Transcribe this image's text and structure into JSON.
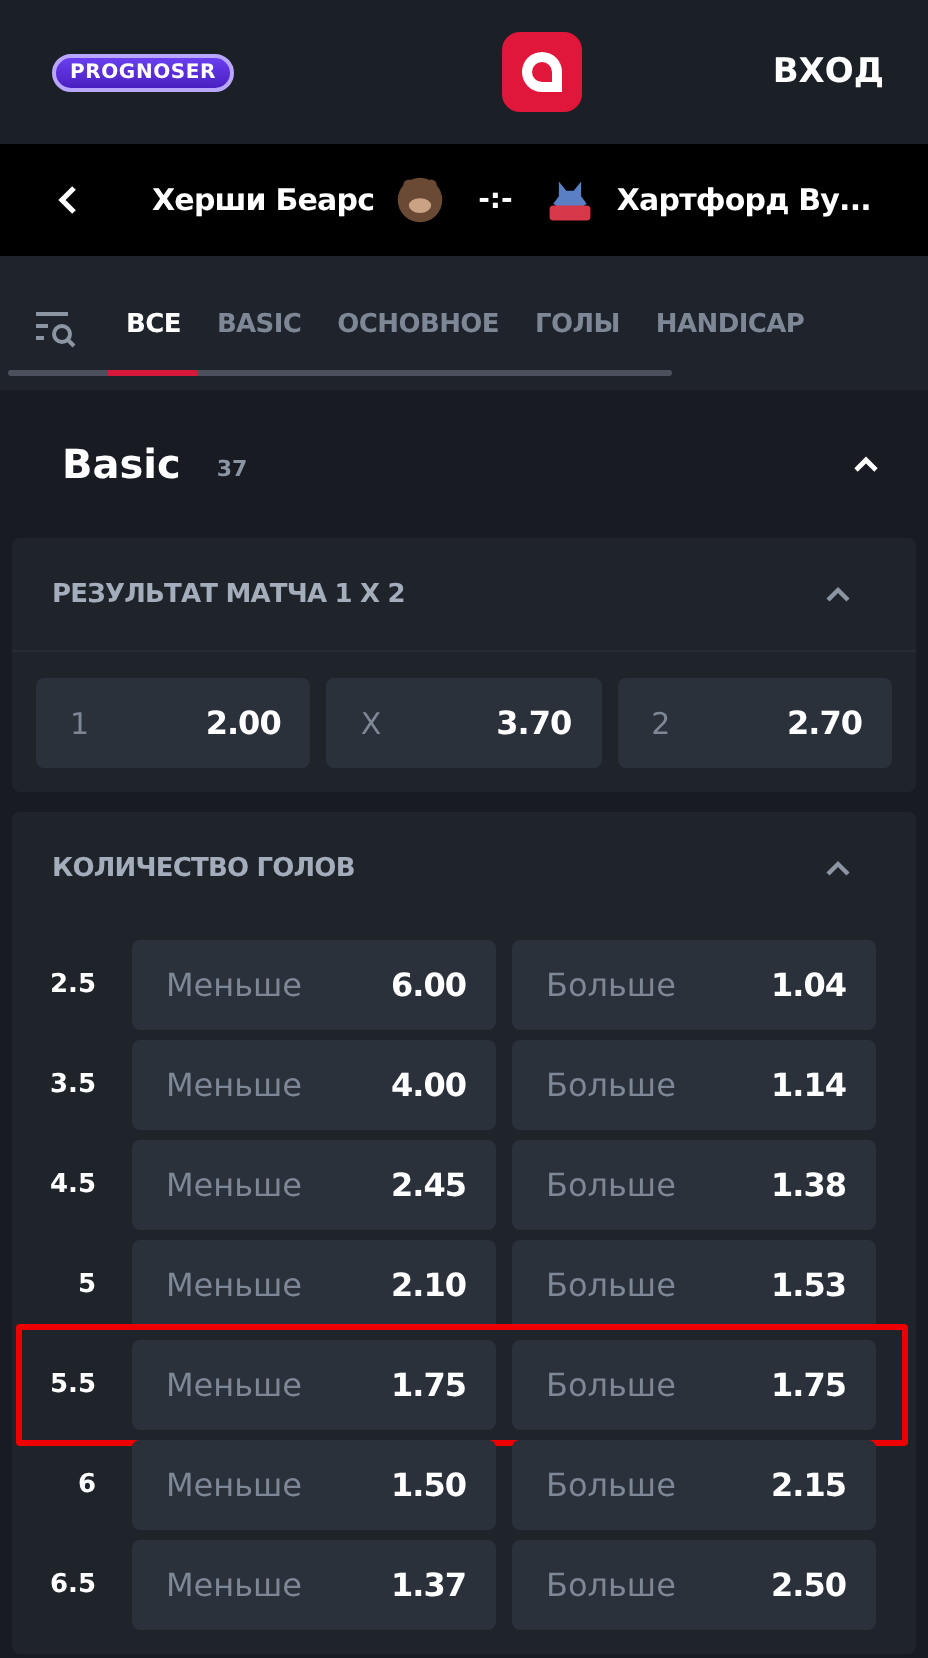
{
  "header": {
    "brand_badge": "PROGNOSER",
    "login": "ВХОД"
  },
  "match": {
    "home": "Херши Беарс",
    "score": "-:-",
    "away": "Хартфорд Ву..."
  },
  "tabs": [
    {
      "label": "ВСЕ",
      "selected": true
    },
    {
      "label": "BASIC",
      "selected": false
    },
    {
      "label": "ОСНОВНОЕ",
      "selected": false
    },
    {
      "label": "ГОЛЫ",
      "selected": false
    },
    {
      "label": "HANDICAP",
      "selected": false
    }
  ],
  "section": {
    "title": "Basic",
    "count": "37",
    "expanded": true
  },
  "markets": [
    {
      "title": "РЕЗУЛЬТАТ МАТЧА 1 X 2",
      "expanded": true,
      "kind": "outcomes",
      "outcomes": [
        {
          "label": "1",
          "odds": "2.00"
        },
        {
          "label": "X",
          "odds": "3.70"
        },
        {
          "label": "2",
          "odds": "2.70"
        }
      ]
    },
    {
      "title": "КОЛИЧЕСТВО ГОЛОВ",
      "expanded": true,
      "kind": "totals",
      "rows": [
        {
          "line": "2.5",
          "under": "Меньше",
          "under_odds": "6.00",
          "over": "Больше",
          "over_odds": "1.04",
          "highlighted": false
        },
        {
          "line": "3.5",
          "under": "Меньше",
          "under_odds": "4.00",
          "over": "Больше",
          "over_odds": "1.14",
          "highlighted": false
        },
        {
          "line": "4.5",
          "under": "Меньше",
          "under_odds": "2.45",
          "over": "Больше",
          "over_odds": "1.38",
          "highlighted": false
        },
        {
          "line": "5",
          "under": "Меньше",
          "under_odds": "2.10",
          "over": "Больше",
          "over_odds": "1.53",
          "highlighted": false
        },
        {
          "line": "5.5",
          "under": "Меньше",
          "under_odds": "1.75",
          "over": "Больше",
          "over_odds": "1.75",
          "highlighted": true
        },
        {
          "line": "6",
          "under": "Меньше",
          "under_odds": "1.50",
          "over": "Больше",
          "over_odds": "2.15",
          "highlighted": false
        },
        {
          "line": "6.5",
          "under": "Меньше",
          "under_odds": "1.37",
          "over": "Больше",
          "over_odds": "2.50",
          "highlighted": false
        }
      ]
    }
  ]
}
